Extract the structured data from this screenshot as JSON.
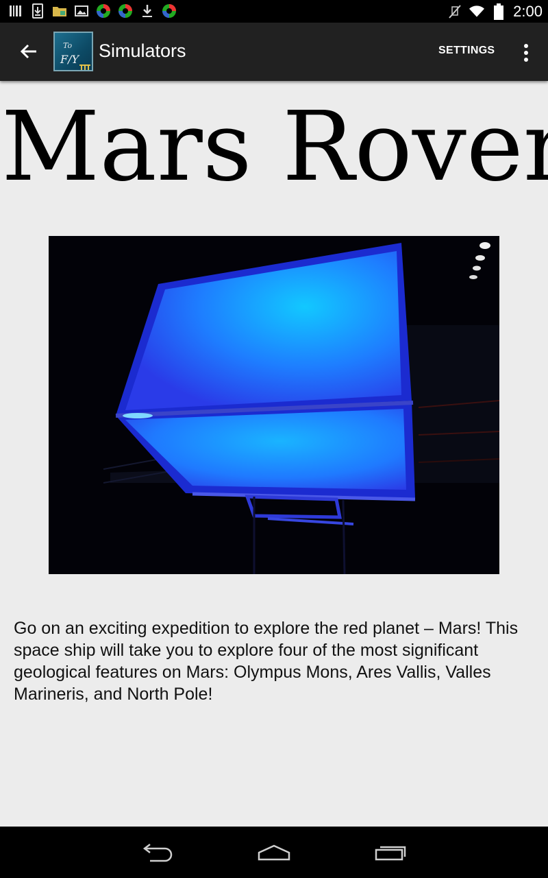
{
  "status_bar": {
    "time": "2:00",
    "left_icons": [
      "barcode-icon",
      "sim-download-icon",
      "folder-icon",
      "image-icon",
      "app-circle-icon",
      "app-circle-icon",
      "download-icon",
      "app-circle-icon"
    ],
    "right_icons": [
      "mute-icon",
      "wifi-icon",
      "battery-icon"
    ]
  },
  "action_bar": {
    "title": "Simulators",
    "settings_label": "SETTINGS",
    "logo_text_top": "To",
    "logo_text_bottom": "F/Y"
  },
  "main": {
    "title": "Mars Rover",
    "description": "Go on an exciting expedition to explore the red planet – Mars! This space ship will take you to explore four of the most significant geological features on Mars: Olympus Mons, Ares Vallis, Valles Marineris, and North Pole!"
  },
  "colors": {
    "action_bar_bg": "#212121",
    "page_bg": "#ececec",
    "simulator_glow": "#1e90ff"
  }
}
